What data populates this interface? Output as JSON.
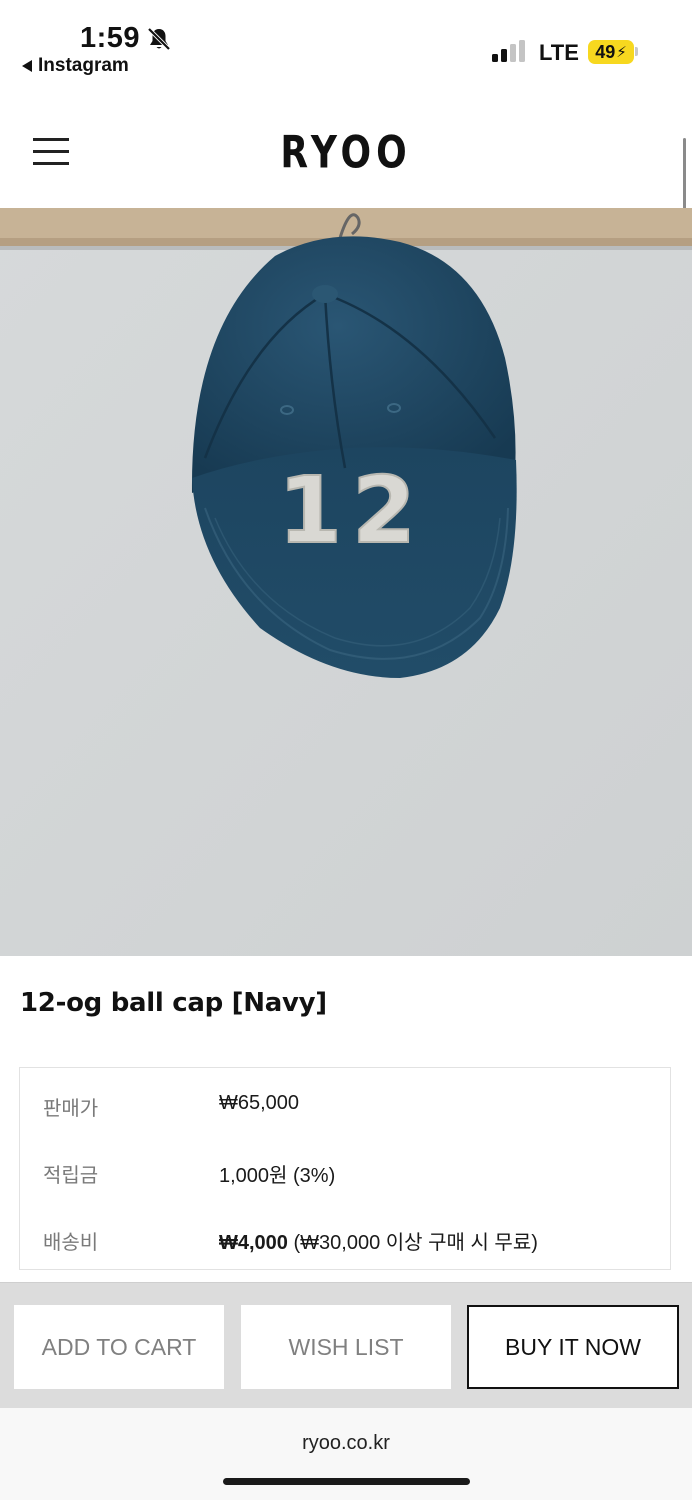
{
  "status_bar": {
    "time": "1:59",
    "back_app": "Instagram",
    "network": "LTE",
    "battery": "49"
  },
  "header": {
    "logo": "RYOO"
  },
  "product": {
    "title": "12-og ball cap [Navy]",
    "patch_number": "12",
    "info": [
      {
        "label": "판매가",
        "value": "₩65,000"
      },
      {
        "label": "적립금",
        "value": "1,000원 (3%)"
      },
      {
        "label": "배송비",
        "value_bold": "₩4,000",
        "value_rest": " (₩30,000 이상 구매 시 무료)"
      }
    ]
  },
  "actions": {
    "add_to_cart": "ADD TO CART",
    "wish_list": "WISH LIST",
    "buy_now": "BUY IT NOW"
  },
  "browser": {
    "url": "ryoo.co.kr"
  },
  "colors": {
    "cap_navy": "#1f4560",
    "wall": "#d2d5d6",
    "shelf": "#c9b59a",
    "battery": "#f7d81f"
  }
}
